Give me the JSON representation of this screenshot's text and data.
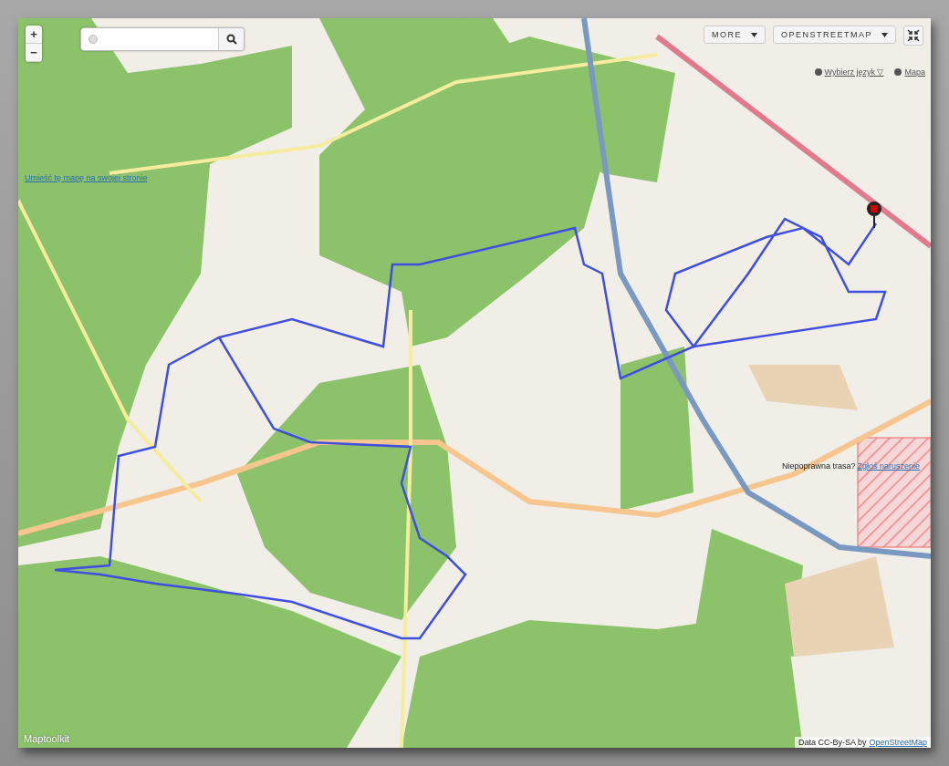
{
  "zoom_controls": [
    {
      "label": "+"
    },
    {
      "label": "−"
    }
  ],
  "map_menus": [
    {
      "label": "MORE"
    },
    {
      "label": "OPENSTREETMAP"
    }
  ],
  "top_links": [
    {
      "label": "Wybierz język ▽"
    },
    {
      "label": "Mapa"
    }
  ],
  "embed_link": "Umieść tę mapę na swojej stronie",
  "report": {
    "text": "Niepoprawna trasa?",
    "link": "Zgłoś naruszenie"
  },
  "brand": "Maptoolkit",
  "attribution": {
    "text": "Data CC-By-SA by",
    "link": "OpenStreetMap"
  }
}
